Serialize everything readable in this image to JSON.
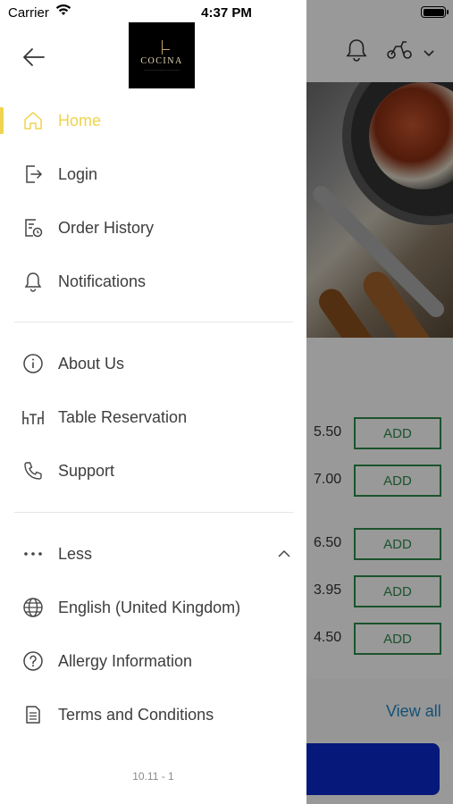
{
  "status_bar": {
    "carrier": "Carrier",
    "time": "4:37 PM"
  },
  "drawer": {
    "logo_text": "COCINA",
    "menu_primary": [
      {
        "label": "Home",
        "icon": "home-icon",
        "active": true
      },
      {
        "label": "Login",
        "icon": "login-icon"
      },
      {
        "label": "Order History",
        "icon": "order-history-icon"
      },
      {
        "label": "Notifications",
        "icon": "bell-icon"
      }
    ],
    "menu_secondary": [
      {
        "label": "About Us",
        "icon": "info-icon"
      },
      {
        "label": "Table Reservation",
        "icon": "table-icon"
      },
      {
        "label": "Support",
        "icon": "phone-icon"
      }
    ],
    "menu_more": [
      {
        "label": "Less",
        "icon": "more-dots-icon"
      },
      {
        "label": "English (United Kingdom)",
        "icon": "globe-icon"
      },
      {
        "label": "Allergy Information",
        "icon": "question-icon"
      },
      {
        "label": "Terms and Conditions",
        "icon": "document-icon"
      }
    ],
    "version": "10.11 - 1",
    "accent_color": "#f0d34e"
  },
  "background": {
    "items": [
      {
        "price": "5.50",
        "action": "ADD"
      },
      {
        "price": "7.00",
        "action": "ADD"
      },
      {
        "price": "6.50",
        "action": "ADD"
      },
      {
        "price": "3.95",
        "action": "ADD"
      },
      {
        "price": "4.50",
        "action": "ADD"
      }
    ],
    "view_all": "View all"
  }
}
